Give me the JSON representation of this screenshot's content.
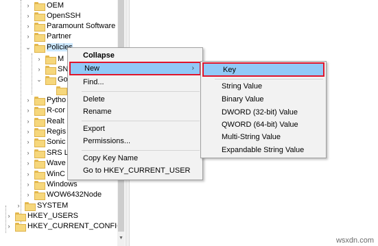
{
  "tree": {
    "items": [
      {
        "label": "OEM"
      },
      {
        "label": "OpenSSH"
      },
      {
        "label": "Paramount Software ("
      },
      {
        "label": "Partner"
      },
      {
        "label": "Policies"
      },
      {
        "label": "M"
      },
      {
        "label": "SN"
      },
      {
        "label": "Go"
      },
      {
        "label": ""
      },
      {
        "label": "Pytho"
      },
      {
        "label": "R-cor"
      },
      {
        "label": "Realt"
      },
      {
        "label": "Regis"
      },
      {
        "label": "Sonic"
      },
      {
        "label": "SRS L"
      },
      {
        "label": "Wave"
      },
      {
        "label": "WinC"
      },
      {
        "label": "Windows"
      },
      {
        "label": "WOW6432Node"
      },
      {
        "label": "SYSTEM"
      },
      {
        "label": "HKEY_USERS"
      },
      {
        "label": "HKEY_CURRENT_CONFIG"
      }
    ]
  },
  "context_menu": {
    "items": [
      {
        "label": "Collapse"
      },
      {
        "label": "New"
      },
      {
        "label": "Find..."
      },
      {
        "label": "Delete"
      },
      {
        "label": "Rename"
      },
      {
        "label": "Export"
      },
      {
        "label": "Permissions..."
      },
      {
        "label": "Copy Key Name"
      },
      {
        "label": "Go to HKEY_CURRENT_USER"
      }
    ],
    "submenu_arrow": "›"
  },
  "submenu": {
    "items": [
      {
        "label": "Key"
      },
      {
        "label": "String Value"
      },
      {
        "label": "Binary Value"
      },
      {
        "label": "DWORD (32-bit) Value"
      },
      {
        "label": "QWORD (64-bit) Value"
      },
      {
        "label": "Multi-String Value"
      },
      {
        "label": "Expandable String Value"
      }
    ]
  },
  "colors": {
    "highlight": "#91c9f7",
    "highlight_border": "#e0142a",
    "folder": "#f6d77c"
  },
  "icons": {
    "expand": "›",
    "collapse": "⌄",
    "scroll_down": "▼"
  },
  "watermark": "wsxdn.com"
}
